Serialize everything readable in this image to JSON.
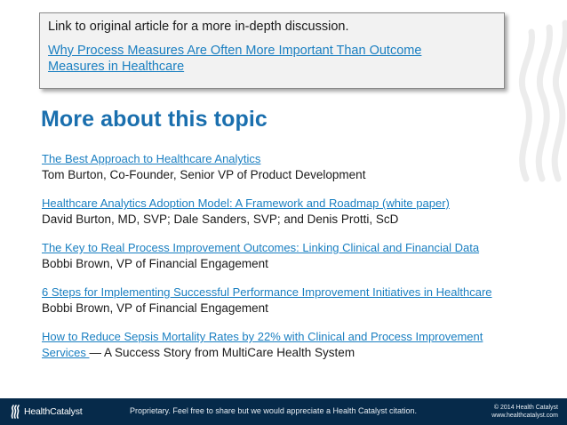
{
  "callout": {
    "intro": "Link to original article for a more in-depth discussion.",
    "link_line1": "Why Process Measures Are Often More Important Than Outcome",
    "link_line2": "Measures in Healthcare"
  },
  "heading": "More about this topic",
  "articles": [
    {
      "title": "The Best Approach to Healthcare Analytics",
      "author": "Tom Burton, Co-Founder, Senior VP of Product Development"
    },
    {
      "title": "Healthcare Analytics Adoption Model: A Framework and Roadmap (white paper)",
      "author": "David Burton, MD, SVP; Dale Sanders, SVP; and Denis Protti, ScD"
    },
    {
      "title": "The Key to Real Process Improvement Outcomes: Linking Clinical and Financial Data",
      "author": "Bobbi Brown, VP of Financial Engagement"
    },
    {
      "title": "6 Steps for Implementing Successful Performance Improvement Initiatives in Healthcare",
      "author": "Bobbi Brown, VP of Financial Engagement"
    },
    {
      "title_line1": "How to Reduce Sepsis Mortality Rates by 22% with Clinical and Process Improvement",
      "title_line2": "Services ",
      "suffix": " — A Success Story from MultiCare Health System"
    }
  ],
  "footer": {
    "brand": "HealthCatalyst",
    "notice": "Proprietary. Feel free to share but we would appreciate a Health Catalyst citation.",
    "copyright": "© 2014 Health Catalyst",
    "website": "www.healthcatalyst.com"
  },
  "colors": {
    "link": "#1a7fc1",
    "heading": "#1a6fae",
    "footer_bg": "#062a4a"
  }
}
